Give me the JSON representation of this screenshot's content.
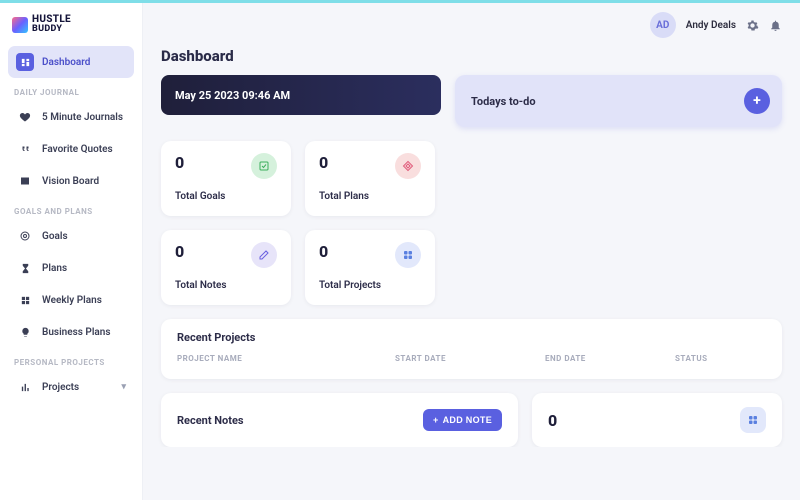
{
  "brand": {
    "line1": "HUSTLE",
    "line2": "BUDDY"
  },
  "user": {
    "initials": "AD",
    "name": "Andy Deals"
  },
  "nav": {
    "dashboard": "Dashboard",
    "section_daily": "DAILY JOURNAL",
    "journal": "5 Minute Journals",
    "quotes": "Favorite Quotes",
    "vision": "Vision Board",
    "section_goals": "GOALS AND PLANS",
    "goals": "Goals",
    "plans": "Plans",
    "weekly": "Weekly Plans",
    "business": "Business Plans",
    "section_projects": "PERSONAL PROJECTS",
    "projects": "Projects"
  },
  "page": {
    "title": "Dashboard",
    "datetime": "May 25 2023 09:46 AM",
    "todo_title": "Todays to-do"
  },
  "stats": {
    "goals": {
      "value": "0",
      "label": "Total Goals"
    },
    "plans": {
      "value": "0",
      "label": "Total Plans"
    },
    "notes": {
      "value": "0",
      "label": "Total Notes"
    },
    "projects": {
      "value": "0",
      "label": "Total Projects"
    }
  },
  "recent_projects": {
    "title": "Recent Projects",
    "cols": {
      "name": "PROJECT NAME",
      "start": "START DATE",
      "end": "END DATE",
      "status": "STATUS"
    }
  },
  "recent_notes": {
    "title": "Recent Notes",
    "add_btn": "ADD NOTE"
  },
  "bottom_stat": {
    "value": "0"
  }
}
